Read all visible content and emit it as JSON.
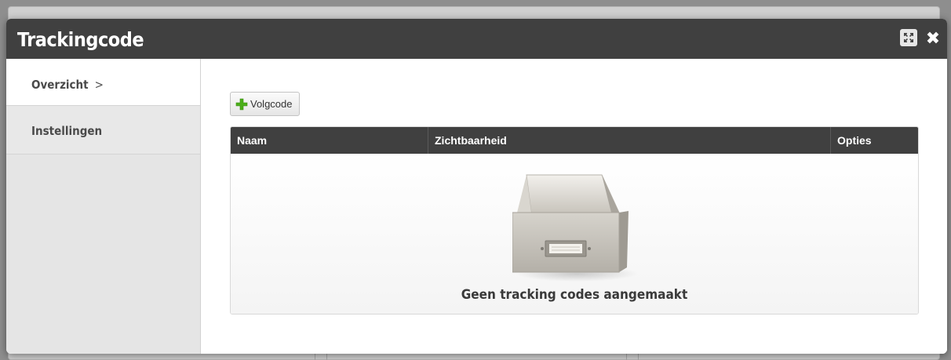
{
  "dialog": {
    "title": "Trackingcode",
    "expand_icon": "expand-icon",
    "close_icon": "close-icon"
  },
  "sidebar": {
    "items": [
      {
        "label": "Overzicht",
        "suffix": ">",
        "active": true
      },
      {
        "label": "Instellingen",
        "active": false
      }
    ]
  },
  "toolbar": {
    "add_label": "Volgcode",
    "add_icon": "plus-icon"
  },
  "table": {
    "columns": [
      "Naam",
      "Zichtbaarheid",
      "Opties"
    ],
    "rows": [],
    "empty_icon": "empty-drawer-icon",
    "empty_message": "Geen tracking codes aangemaakt"
  },
  "colors": {
    "titlebar": "#404040",
    "plus_green": "#4caf1a",
    "sidebar_bg": "#e5e5e5"
  }
}
